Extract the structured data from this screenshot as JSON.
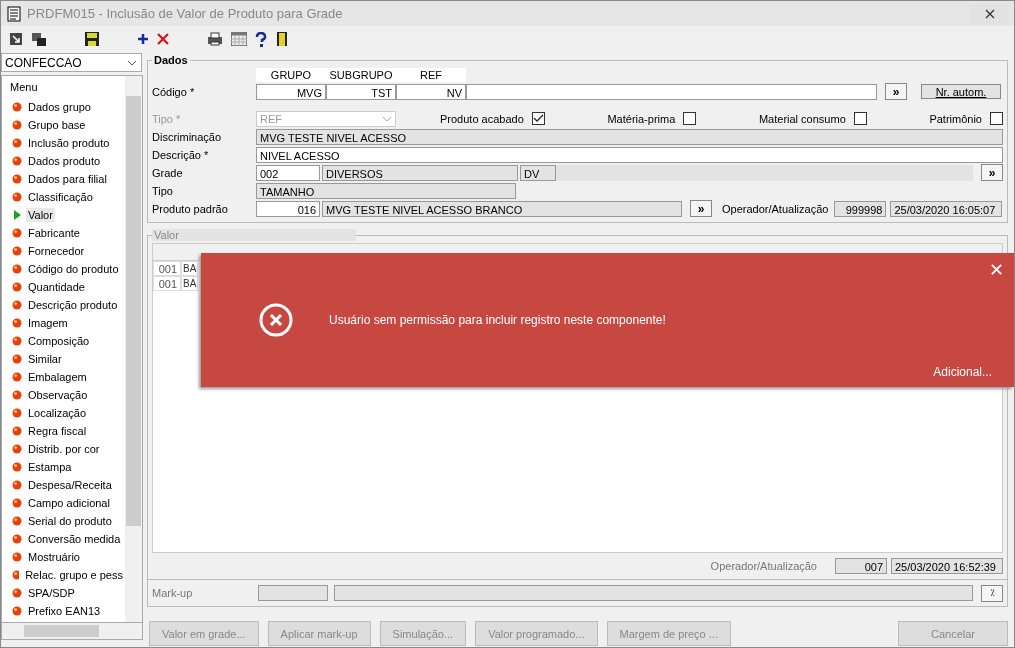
{
  "window": {
    "title": "PRDFM015 - Inclusão de Valor de Produto para Grade"
  },
  "sidebar": {
    "module": "CONFECCAO",
    "menu_title": "Menu",
    "items": [
      {
        "label": "Dados grupo",
        "selected": false
      },
      {
        "label": "Grupo base",
        "selected": false
      },
      {
        "label": "Inclusão produto",
        "selected": false
      },
      {
        "label": "Dados produto",
        "selected": false
      },
      {
        "label": "Dados para filial",
        "selected": false
      },
      {
        "label": "Classificação",
        "selected": false
      },
      {
        "label": "Valor",
        "selected": true
      },
      {
        "label": "Fabricante",
        "selected": false
      },
      {
        "label": "Fornecedor",
        "selected": false
      },
      {
        "label": "Código do produto",
        "selected": false
      },
      {
        "label": "Quantidade",
        "selected": false
      },
      {
        "label": "Descrição produto",
        "selected": false
      },
      {
        "label": "Imagem",
        "selected": false
      },
      {
        "label": "Composição",
        "selected": false
      },
      {
        "label": "Similar",
        "selected": false
      },
      {
        "label": "Embalagem",
        "selected": false
      },
      {
        "label": "Observação",
        "selected": false
      },
      {
        "label": "Localização",
        "selected": false
      },
      {
        "label": "Regra fiscal",
        "selected": false
      },
      {
        "label": "Distrib. por cor",
        "selected": false
      },
      {
        "label": "Estampa",
        "selected": false
      },
      {
        "label": "Despesa/Receita",
        "selected": false
      },
      {
        "label": "Campo adicional",
        "selected": false
      },
      {
        "label": "Serial do produto",
        "selected": false
      },
      {
        "label": "Conversão medida",
        "selected": false
      },
      {
        "label": "Mostruário",
        "selected": false
      },
      {
        "label": "Relac. grupo e pess",
        "selected": false
      },
      {
        "label": "SPA/SDP",
        "selected": false
      },
      {
        "label": "Prefixo EAN13",
        "selected": false
      }
    ]
  },
  "dados": {
    "legend": "Dados",
    "codigo": {
      "label": "Código *",
      "columns": [
        "GRUPO",
        "SUBGRUPO",
        "REF"
      ],
      "values": [
        "MVG",
        "TST",
        "NV"
      ],
      "more": "»",
      "auto_button": "Nr. autom."
    },
    "tipo": {
      "label": "Tipo *",
      "value": "REF",
      "disabled": true
    },
    "checks": [
      {
        "label": "Produto acabado",
        "checked": true
      },
      {
        "label": "Matéria-prima",
        "checked": false
      },
      {
        "label": "Material consumo",
        "checked": false
      },
      {
        "label": "Patrimônio",
        "checked": false
      }
    ],
    "discriminacao": {
      "label": "Discriminação",
      "value": "MVG TESTE NIVEL ACESSO"
    },
    "descricao": {
      "label": "Descrição *",
      "value": "NIVEL ACESSO"
    },
    "grade": {
      "label": "Grade",
      "code": "002",
      "name": "DIVERSOS",
      "abbr": "DV",
      "more": "»"
    },
    "tipo2": {
      "label": "Tipo",
      "value": "TAMANHO"
    },
    "produto_padrao": {
      "label": "Produto padrão",
      "code": "016",
      "name": "MVG TESTE NIVEL ACESSO BRANCO",
      "more": "»"
    },
    "operador": {
      "label": "Operador/Atualização",
      "code": "999998",
      "date": "25/03/2020 16:05:07"
    }
  },
  "valor": {
    "legend": "Valor",
    "rows": [
      [
        "001",
        "BA"
      ],
      [
        "001",
        "BA"
      ]
    ],
    "operador": {
      "label": "Operador/Atualização",
      "code": "007",
      "date": "25/03/2020 16:52:39"
    }
  },
  "markup": {
    "label": "Mark-up",
    "button": "⁒"
  },
  "buttons": [
    {
      "label": "Valor em grade...",
      "disabled": true
    },
    {
      "label": "Aplicar mark-up",
      "disabled": true
    },
    {
      "label": "Simulação...",
      "disabled": true
    },
    {
      "label": "Valor programado...",
      "disabled": true
    },
    {
      "label": "Margem de preço ...",
      "disabled": true
    }
  ],
  "cancel": {
    "label": "Cancelar",
    "disabled": true
  },
  "toast": {
    "message": "Usuário sem permissão para incluir registro neste componente!",
    "link": "Adicional...",
    "close": "✕"
  }
}
